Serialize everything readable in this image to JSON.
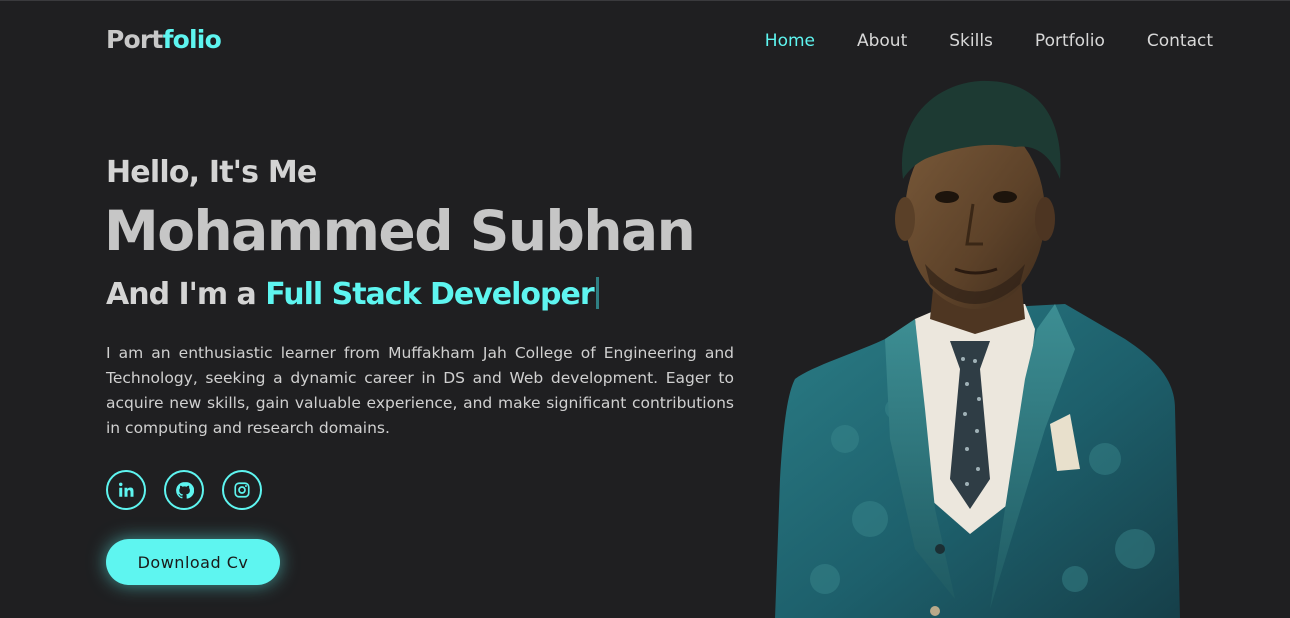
{
  "header": {
    "logo_prefix": "Port",
    "logo_suffix": "folio",
    "nav": [
      {
        "label": "Home",
        "active": true
      },
      {
        "label": "About",
        "active": false
      },
      {
        "label": "Skills",
        "active": false
      },
      {
        "label": "Portfolio",
        "active": false
      },
      {
        "label": "Contact",
        "active": false
      }
    ]
  },
  "hero": {
    "greeting": "Hello, It's Me",
    "name": "Mohammed Subhan",
    "role_prefix": "And I'm a ",
    "role_typed": "Full Stack Developer",
    "description": "I am an enthusiastic learner from Muffakham Jah College of Engineering and Technology, seeking a dynamic career in DS and Web development. Eager to acquire new skills, gain valuable experience, and make significant contributions in computing and research domains.",
    "social_icons": [
      "linkedin-icon",
      "github-icon",
      "instagram-icon"
    ],
    "download_label": "Download Cv"
  },
  "colors": {
    "accent": "#5ef5f0",
    "background": "#1f1f21",
    "text": "#c6c6c6"
  }
}
